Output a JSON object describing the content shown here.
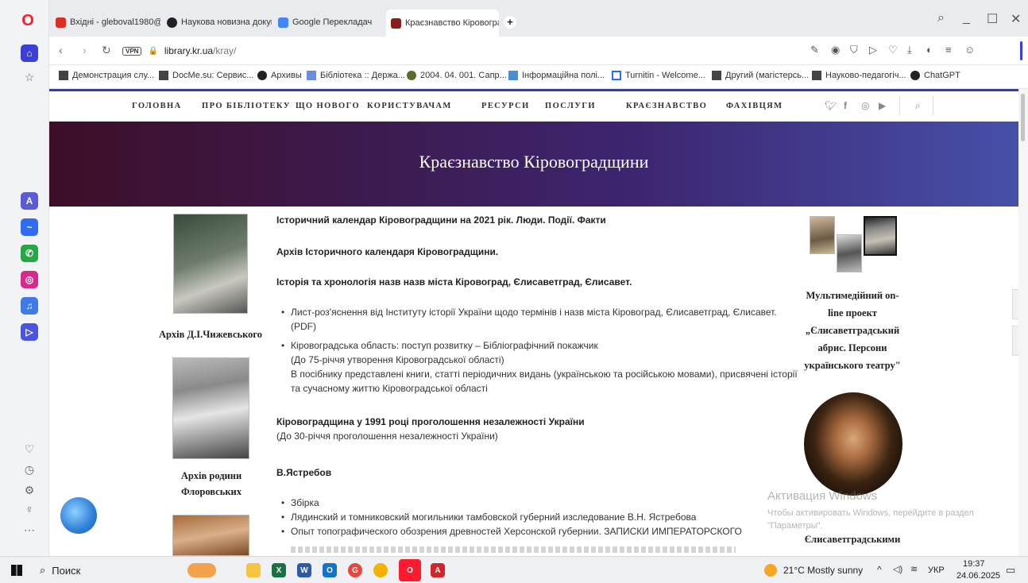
{
  "browser": {
    "tabs": [
      {
        "label": "Вхідні - gleboval1980@gm",
        "color": "#d93025"
      },
      {
        "label": "Наукова новизна докуме",
        "color": "#222222"
      },
      {
        "label": "Google Перекладач",
        "color": "#4285f4"
      },
      {
        "label": "Краєзнавство Кіровоград",
        "color": "#8b1c1c"
      }
    ],
    "new_tab_label": "+",
    "url_prefix": "library.kr.ua",
    "url_path": "/kray/",
    "vpn_label": "VPN",
    "win_search": "⌕",
    "win_min": "_",
    "win_max": "☐",
    "win_close": "✕"
  },
  "bookmarks": [
    "Демонстрация слу...",
    "DocMe.su: Сервис...",
    "Архивы",
    "Бібліотека :: Держа...",
    "2004. 04. 001. Сапр...",
    "Інформаційна полі...",
    "Turnitin - Welcome...",
    "Другий (магістерсь...",
    "Науково-педагогіч...",
    "ChatGPT"
  ],
  "site_nav": [
    "ГОЛОВНА",
    "ПРО БІБЛІОТЕКУ",
    "ЩО НОВОГО",
    "КОРИСТУВАЧАМ",
    "РЕСУРСИ",
    "ПОСЛУГИ",
    "КРАЄЗНАВСТВО",
    "ФАХІВЦЯМ"
  ],
  "hero_title": "Краєзнавство Кіровоградщини",
  "left_captions": {
    "chyzhevsky": "Архів Д.І.Чижевського",
    "florovsky_1": "Архів родини",
    "florovsky_2": "Флоровських"
  },
  "main": {
    "link1": "Історичний календар Кіровоградщини на 2021 рік. Люди. Події. Факти",
    "link2": "Архів Історичного календаря Кіровоградщини.",
    "link3": "Історія та хронологія назв назв міста Кіровоград, Єлисаветград, Єлисавет.",
    "bullet1_line1": "Лист-роз'яснення від Інституту історії України щодо термінів і назв міста Кіровоград, Єлисаветград, Єлисавет.",
    "bullet1_line2": "(PDF)",
    "bullet2": "Кіровоградська область: поступ розвитку – Бібліографічний покажчик",
    "bullet2_sub1": "(До 75-річчя утворення Кіровоградської області)",
    "bullet2_sub2": "В посібнику представлені книги, статті періодичних видань (українською та російською мовами), присвячені історії",
    "bullet2_sub3": "та сучасному життю Кіровоградської області",
    "link4": "Кіровоградщина у 1991 році проголошення незалежності України",
    "link4_sub": "(До 30-річчя проголошення незалежності України)",
    "link5": "В.Ястребов",
    "bullet3": "Збірка",
    "bullet4": "Лядинский и томниковский могильники тамбовской губерний изследование В.Н. Ястребова",
    "bullet5": "Опыт топографического обозрения древностей Херсонской губернии. ЗАПИСКИ ИМПЕРАТОРСКОГО"
  },
  "right_captions": {
    "line1": "Мультимедійний on-",
    "line2": "line проект",
    "line3": "„Єлисаветградський",
    "line4": "абрис. Персони",
    "line5": "українського театру\"",
    "bottom": "Єлисаветградськими"
  },
  "a11y": {
    "contrast": "◐",
    "font": "тT"
  },
  "watermark": {
    "title": "Активация Windows",
    "line1": "Чтобы активировать Windows, перейдите в раздел",
    "line2": "\"Параметры\"."
  },
  "taskbar": {
    "search_label": "Поиск",
    "weather": "21°C Mostly sunny",
    "lang": "УКР",
    "time": "19:37",
    "date": "24.06.2025"
  },
  "colors": {
    "nav_accent": "#3b3f87",
    "hero_start": "#3d0e27",
    "hero_end": "#4650a8",
    "opera_red": "#ff1b2d"
  }
}
